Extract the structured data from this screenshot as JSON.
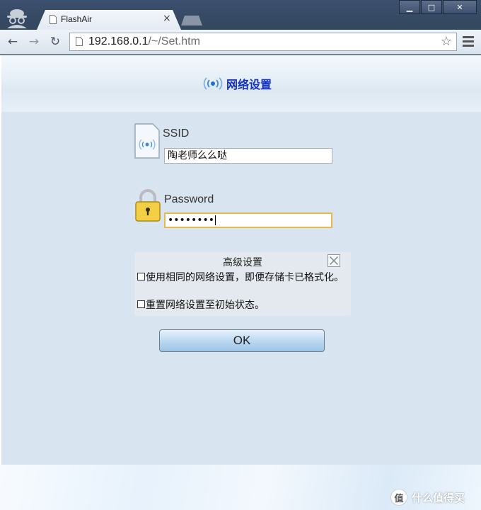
{
  "browser": {
    "tab_title": "FlashAir",
    "tab_close": "×",
    "url_host": "192.168.0.1",
    "url_path": "/~/Set.htm",
    "window_buttons": {
      "minimize": "▁",
      "maximize": "□",
      "close": "✕"
    }
  },
  "page": {
    "title": "网络设置",
    "ssid_label": "SSID",
    "ssid_value": "陶老师么么哒",
    "password_label": "Password",
    "password_value": "••••••••",
    "advanced": {
      "title": "高级设置",
      "options": [
        {
          "label": "使用相同的网络设置，即便存储卡已格式化。",
          "checked": false
        },
        {
          "label": "重置网络设置至初始状态。",
          "checked": false
        }
      ]
    },
    "ok_label": "OK"
  },
  "watermark": {
    "badge": "值",
    "text": "什么值得买"
  },
  "colors": {
    "title": "#1030c0",
    "page_bg": "#d8e4f0",
    "focus_border": "#e8b84e",
    "chrome": "#33475f"
  }
}
